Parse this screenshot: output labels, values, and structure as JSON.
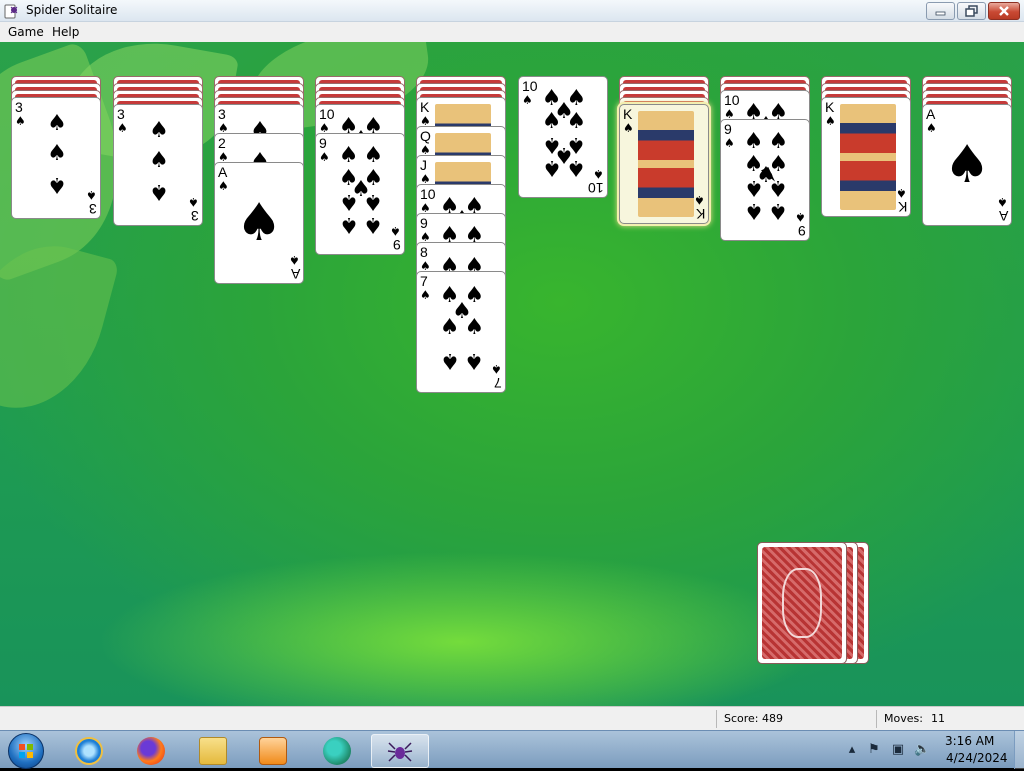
{
  "window": {
    "title": "Spider Solitaire",
    "app_icon": "spider-icon",
    "controls": [
      "minimize-icon",
      "restore-icon",
      "close-icon"
    ]
  },
  "menu": {
    "game": "Game",
    "help": "Help"
  },
  "status": {
    "score_label": "Score: 489",
    "moves_label": "Moves:",
    "moves_value": "11"
  },
  "suit_symbol": "♠",
  "columns": [
    {
      "facedown": 3,
      "cards": [
        "3"
      ]
    },
    {
      "facedown": 4,
      "cards": [
        "3"
      ]
    },
    {
      "facedown": 4,
      "cards": [
        "3",
        "2",
        "A"
      ]
    },
    {
      "facedown": 4,
      "cards": [
        "10",
        "9"
      ]
    },
    {
      "facedown": 3,
      "cards": [
        "K",
        "Q",
        "J",
        "10",
        "9",
        "8",
        "7"
      ]
    },
    {
      "facedown": 0,
      "cards": [
        "10"
      ]
    },
    {
      "facedown": 4,
      "cards": [
        "K"
      ],
      "highlight": true
    },
    {
      "facedown": 2,
      "cards": [
        "10",
        "9"
      ]
    },
    {
      "facedown": 3,
      "cards": [
        "K"
      ]
    },
    {
      "facedown": 4,
      "cards": [
        "A"
      ]
    }
  ],
  "stock": {
    "piles": 3
  },
  "taskbar": {
    "items": [
      "start-orb",
      "internet-explorer-icon",
      "firefox-icon",
      "file-explorer-icon",
      "media-player-icon",
      "browser-icon",
      "spider-solitaire-icon"
    ],
    "tray": [
      "show-hidden-icons-icon",
      "action-center-flag-icon",
      "network-icon",
      "volume-muted-icon"
    ],
    "time": "3:16 AM",
    "date": "4/24/2024"
  },
  "colors": {
    "table": "#2aa14a",
    "card_back": "#c53a3a",
    "taskbar": "#9cb9d6"
  }
}
